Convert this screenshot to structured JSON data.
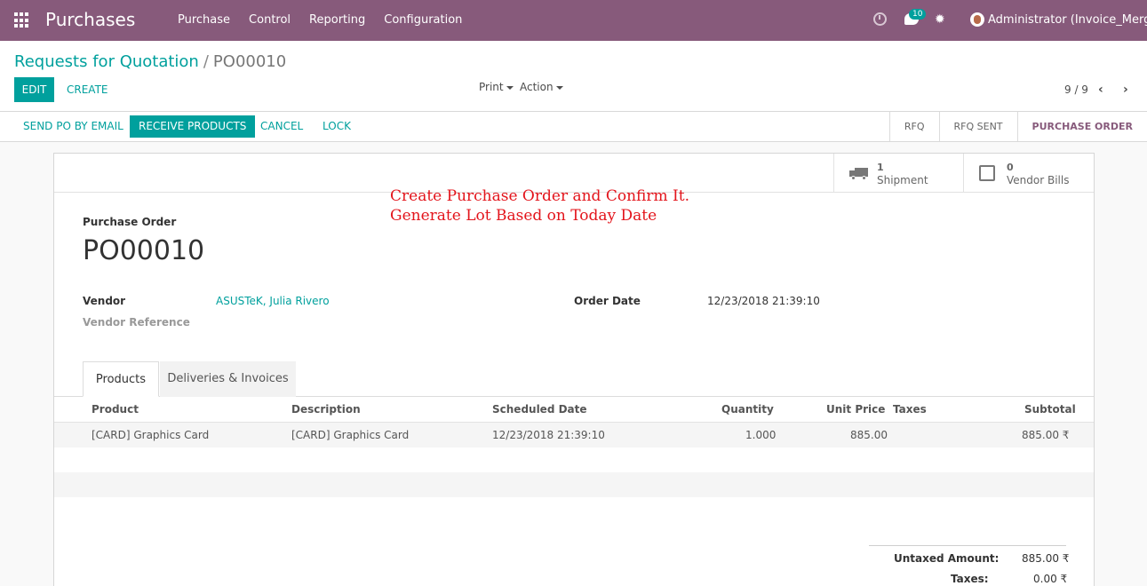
{
  "navbar": {
    "app_title": "Purchases",
    "menu": [
      "Purchase",
      "Control",
      "Reporting",
      "Configuration"
    ],
    "chat_badge": "10",
    "user": "Administrator (Invoice_Merge)",
    "bg_color": "#875a7b"
  },
  "control_panel": {
    "breadcrumb_parent": "Requests for Quotation",
    "breadcrumb_sep": "/",
    "breadcrumb_current": "PO00010",
    "edit_label": "EDIT",
    "create_label": "CREATE",
    "print_label": "Print",
    "action_label": "Action",
    "pager": "9 / 9"
  },
  "statusbar": {
    "send_po": "SEND PO BY EMAIL",
    "receive": "RECEIVE PRODUCTS",
    "cancel": "CANCEL",
    "lock": "LOCK",
    "stages": [
      "RFQ",
      "RFQ SENT",
      "PURCHASE ORDER"
    ],
    "active_stage": "PURCHASE ORDER"
  },
  "smart_buttons": {
    "shipment_count": "1",
    "shipment_label": "Shipment",
    "bills_count": "0",
    "bills_label": "Vendor Bills"
  },
  "annotation": {
    "line1": "Create Purchase Order and Confirm It.",
    "line2": "Generate Lot Based on Today Date"
  },
  "form": {
    "title_label": "Purchase Order",
    "po_number": "PO00010",
    "vendor_label": "Vendor",
    "vendor_value": "ASUSTeK, Julia Rivero",
    "vendor_ref_label": "Vendor Reference",
    "order_date_label": "Order Date",
    "order_date_value": "12/23/2018 21:39:10"
  },
  "tabs": {
    "products": "Products",
    "deliveries": "Deliveries & Invoices"
  },
  "table": {
    "headers": [
      "Product",
      "Description",
      "Scheduled Date",
      "Quantity",
      "Unit Price",
      "Taxes",
      "Subtotal"
    ],
    "rows": [
      {
        "product": "[CARD] Graphics Card",
        "description": "[CARD] Graphics Card",
        "scheduled_date": "12/23/2018 21:39:10",
        "quantity": "1.000",
        "unit_price": "885.00",
        "taxes": "",
        "subtotal": "885.00 ₹"
      }
    ]
  },
  "totals": {
    "untaxed_label": "Untaxed Amount:",
    "untaxed_value": "885.00 ₹",
    "taxes_label": "Taxes:",
    "taxes_value": "0.00 ₹"
  }
}
